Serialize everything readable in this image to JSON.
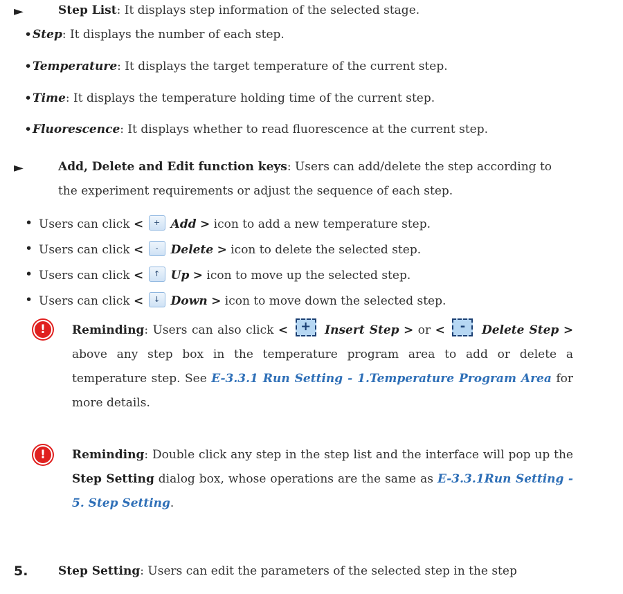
{
  "step_list": {
    "marker": "►",
    "title": "Step List",
    "desc": ": It displays step information of the selected stage.",
    "items": [
      {
        "term": "Step",
        "desc": ": It displays the number of each step."
      },
      {
        "term": "Temperature",
        "desc": ": It displays the target temperature of the current step."
      },
      {
        "term": "Time",
        "desc": ": It displays the temperature holding time of the current step."
      },
      {
        "term": "Fluorescence",
        "desc": ": It displays whether to read fluorescence at the current step."
      }
    ]
  },
  "function_keys": {
    "marker": "►",
    "title": "Add, Delete and Edit function keys",
    "desc_line1": ": Users can add/delete the step according to",
    "desc_line2": "the experiment requirements or adjust the sequence of each step.",
    "items": [
      {
        "prefix": "Users can click ",
        "lt": "<",
        "icon": "+",
        "term": "Add",
        "gt": ">",
        "suffix": " icon to add a new temperature step."
      },
      {
        "prefix": "Users can click ",
        "lt": "<",
        "icon": "-",
        "term": "Delete",
        "gt": ">",
        "suffix": " icon to delete the selected step."
      },
      {
        "prefix": "Users can click ",
        "lt": "<",
        "icon": "↑",
        "term": "Up",
        "gt": ">",
        "suffix": " icon to move up the selected step."
      },
      {
        "prefix": "Users can click ",
        "lt": "<",
        "icon": "↓",
        "term": "Down",
        "gt": ">",
        "suffix": " icon to move down the selected step."
      }
    ]
  },
  "reminder1": {
    "label": "Reminding",
    "text1": ": Users can also click ",
    "insert_icon": "+",
    "insert_term": "Insert Step",
    "or_text": " or ",
    "delete_icon": "-",
    "delete_term": "Delete Step",
    "text2": "above any step box in the temperature program area to add or delete a temperature step. See ",
    "link": "E-3.3.1 Run Setting - 1.Temperature Program Area",
    "text3": " for more details."
  },
  "reminder2": {
    "label": "Reminding",
    "text1": ": Double click any step in the step list and the interface will pop up the ",
    "bold": "Step Setting",
    "text2": " dialog box, whose operations are the same as ",
    "link": "E-3.3.1Run Setting - 5. Step Setting",
    "text3": "."
  },
  "section5": {
    "number": "5.",
    "title": "Step Setting",
    "desc": ": Users can edit the parameters of the selected step in the step"
  },
  "colors": {
    "link": "#2e6fb7",
    "warning": "#e0201f",
    "icon_fill": "#b6d7f3"
  }
}
